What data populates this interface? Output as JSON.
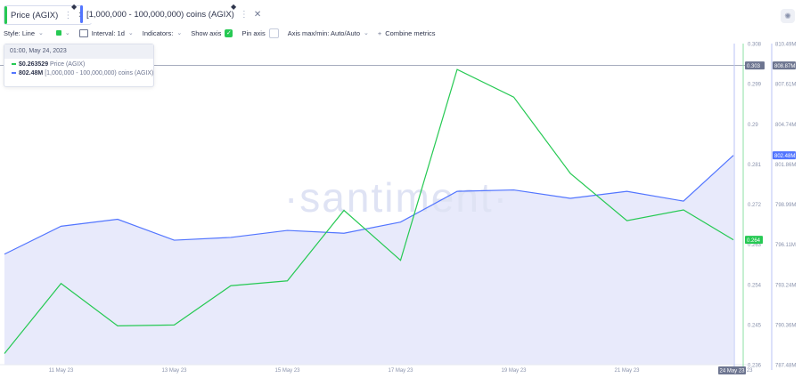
{
  "tabs": [
    {
      "label": "Price (AGIX)",
      "color": "#26c953"
    },
    {
      "label": "[1,000,000 - 100,000,000) coins (AGIX)",
      "color": "#5275ff"
    }
  ],
  "toolbar": {
    "style_label": "Style: Line",
    "interval_label": "Interval: 1d",
    "indicators_label": "Indicators:",
    "show_axis_label": "Show axis",
    "pin_axis_label": "Pin axis",
    "axis_maxmin_label": "Axis max/min: Auto/Auto",
    "combine_label": "Combine metrics"
  },
  "tooltip": {
    "date": "01:00, May 24, 2023",
    "price_value": "$0.263529",
    "price_label": "Price (AGIX)",
    "coins_value": "802.48M",
    "coins_label": "[1,000,000 - 100,000,000) coins (AGIX)"
  },
  "watermark": "·santiment·",
  "chart_data": {
    "type": "line",
    "x": [
      "10 May 23",
      "11 May 23",
      "12 May 23",
      "13 May 23",
      "14 May 23",
      "15 May 23",
      "16 May 23",
      "17 May 23",
      "18 May 23",
      "19 May 23",
      "20 May 23",
      "21 May 23",
      "22 May 23",
      "23 May 23",
      "24 May 23"
    ],
    "x_tick_labels": [
      "11 May 23",
      "13 May 23",
      "15 May 23",
      "17 May 23",
      "19 May 23",
      "21 May 23",
      "23 May 23"
    ],
    "current_x_label": "24 May 23",
    "series": [
      {
        "name": "Price (AGIX)",
        "axis": "right_inner",
        "color": "#26c953",
        "values": [
          0.2385,
          0.2542,
          0.2447,
          0.2449,
          0.2537,
          0.2548,
          0.2706,
          0.2594,
          0.3022,
          0.296,
          0.2789,
          0.2683,
          0.2707,
          0.264,
          0.2645
        ],
        "last_label": "0.264"
      },
      {
        "name": "[1,000,000 - 100,000,000) coins (AGIX)",
        "axis": "right_outer",
        "color": "#5275ff",
        "values": [
          795.4,
          797.4,
          797.9,
          796.4,
          796.6,
          797.1,
          796.9,
          797.7,
          799.9,
          800.0,
          799.4,
          799.9,
          799.2,
          802.48,
          802.48
        ],
        "last_label": "802.48M"
      }
    ],
    "price_axis": {
      "min": 0.236,
      "max": 0.308,
      "ticks": [
        "0.308",
        "0.299",
        "0.29",
        "0.281",
        "0.272",
        "0.263",
        "0.254",
        "0.245",
        "0.236"
      ],
      "ref_label": "0.303",
      "ref_value": 0.3031
    },
    "coins_axis": {
      "min": 787.48,
      "max": 810.49,
      "ticks": [
        "810.49M",
        "807.61M",
        "804.74M",
        "801.86M",
        "798.99M",
        "796.11M",
        "793.24M",
        "790.36M",
        "787.48M"
      ],
      "ref_label": "808.87M"
    },
    "grid": false,
    "legend": "top-left"
  }
}
